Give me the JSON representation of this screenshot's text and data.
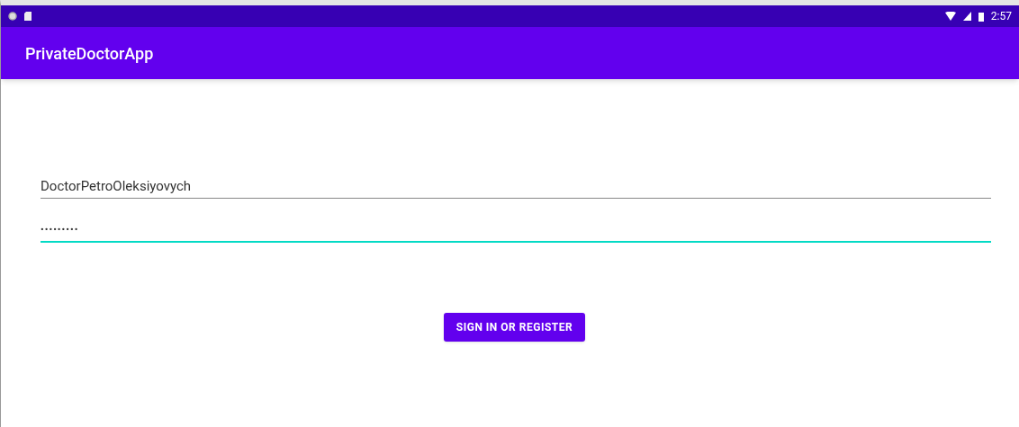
{
  "status_bar": {
    "time": "2:57"
  },
  "app_bar": {
    "title": "PrivateDoctorApp"
  },
  "fields": [
    {
      "kind": "text",
      "value": "DoctorPetroOleksiyovych",
      "focused": false
    },
    {
      "kind": "password",
      "value": "•••••••••",
      "focused": true
    }
  ],
  "button": {
    "label": "SIGN IN OR REGISTER"
  }
}
